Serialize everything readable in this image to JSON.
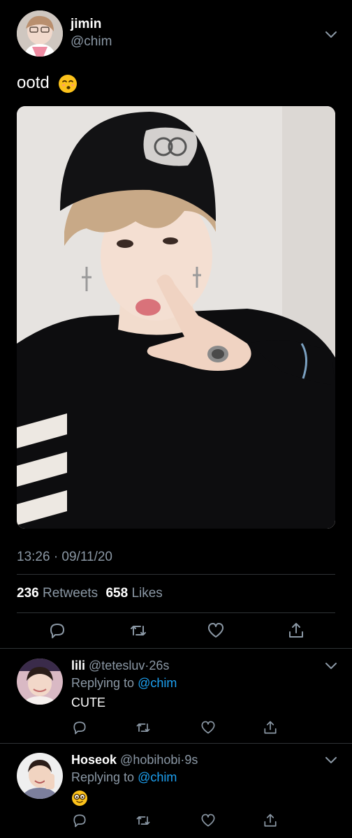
{
  "tweet": {
    "author_name": "jimin",
    "author_handle": "@chim",
    "text": "ootd",
    "text_emoji": "kissing-face-emoji",
    "timestamp": "13:26 · 09/11/20",
    "retweets_count": "236",
    "retweets_label": "Retweets",
    "likes_count": "658",
    "likes_label": "Likes",
    "media": "photo"
  },
  "replies": [
    {
      "name": "lili",
      "handle": "@tetesluv",
      "time": "26s",
      "replying_prefix": "Replying to",
      "replying_to": "@chim",
      "text": "CUTE"
    },
    {
      "name": "Hoseok",
      "handle": "@hobihobi",
      "time": "9s",
      "replying_prefix": "Replying to",
      "replying_to": "@chim",
      "text": "",
      "text_emoji": "face-with-monocle-glasses-emoji"
    }
  ],
  "icons": {
    "reply": "reply-icon",
    "retweet": "retweet-icon",
    "like": "heart-icon",
    "share": "share-icon",
    "more": "chevron-down-icon"
  },
  "colors": {
    "background": "#000000",
    "text": "#ffffff",
    "secondary": "#8b98a5",
    "link": "#1da1f2",
    "divider": "#2f3336"
  }
}
